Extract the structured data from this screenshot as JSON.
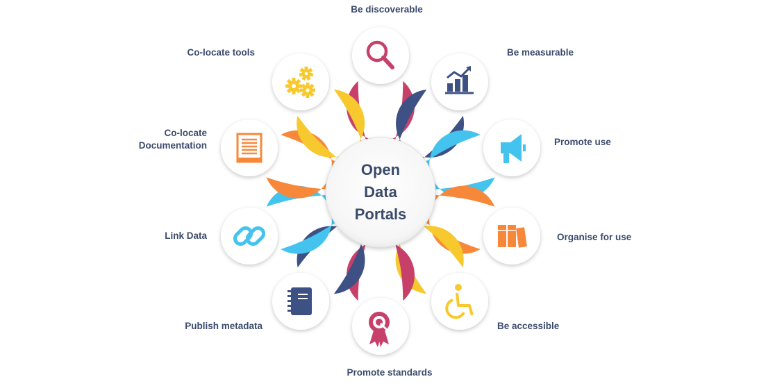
{
  "center": {
    "lines": [
      "Open",
      "Data",
      "Portals"
    ]
  },
  "petals": [
    {
      "id": "discoverable",
      "label": [
        "Be discoverable"
      ],
      "color": "#c7406a",
      "icon": "magnifier-icon"
    },
    {
      "id": "measurable",
      "label": [
        "Be measurable"
      ],
      "color": "#3e5184",
      "icon": "bar-chart-icon"
    },
    {
      "id": "promote-use",
      "label": [
        "Promote use"
      ],
      "color": "#45c3ef",
      "icon": "megaphone-icon"
    },
    {
      "id": "organise",
      "label": [
        "Organise for use"
      ],
      "color": "#f7883a",
      "icon": "books-icon"
    },
    {
      "id": "accessible",
      "label": [
        "Be accessible"
      ],
      "color": "#f7c92f",
      "icon": "wheelchair-icon"
    },
    {
      "id": "standards",
      "label": [
        "Promote standards"
      ],
      "color": "#c7406a",
      "icon": "award-ribbon-icon"
    },
    {
      "id": "metadata",
      "label": [
        "Publish metadata"
      ],
      "color": "#3e5184",
      "icon": "notebook-icon"
    },
    {
      "id": "link-data",
      "label": [
        "Link Data"
      ],
      "color": "#45c3ef",
      "icon": "chain-link-icon"
    },
    {
      "id": "documentation",
      "label": [
        "Co-locate",
        "Documentation"
      ],
      "color": "#f7883a",
      "icon": "document-icon"
    },
    {
      "id": "tools",
      "label": [
        "Co-locate tools"
      ],
      "color": "#f7c92f",
      "icon": "gears-icon"
    }
  ]
}
